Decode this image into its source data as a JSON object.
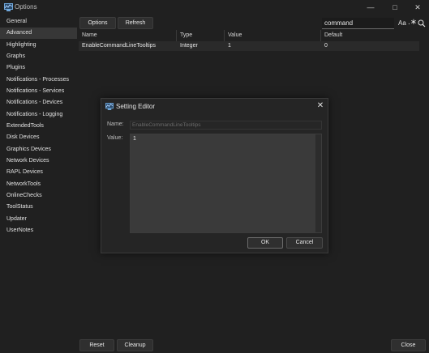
{
  "window": {
    "title": "Options"
  },
  "sidebar": {
    "items": [
      {
        "label": "General"
      },
      {
        "label": "Advanced"
      },
      {
        "label": "Highlighting"
      },
      {
        "label": "Graphs"
      },
      {
        "label": "Plugins"
      },
      {
        "label": "Notifications - Processes"
      },
      {
        "label": "Notifications - Services"
      },
      {
        "label": "Notifications - Devices"
      },
      {
        "label": "Notifications - Logging"
      },
      {
        "label": "ExtendedTools"
      },
      {
        "label": "Disk Devices"
      },
      {
        "label": "Graphics Devices"
      },
      {
        "label": "Network Devices"
      },
      {
        "label": "RAPL Devices"
      },
      {
        "label": "NetworkTools"
      },
      {
        "label": "OnlineChecks"
      },
      {
        "label": "ToolStatus"
      },
      {
        "label": "Updater"
      },
      {
        "label": "UserNotes"
      }
    ],
    "selected": "Advanced"
  },
  "toolbar": {
    "options_label": "Options",
    "refresh_label": "Refresh"
  },
  "search": {
    "value": "command",
    "match_case_icon": "Aa"
  },
  "table": {
    "columns": [
      "Name",
      "Type",
      "Value",
      "Default"
    ],
    "rows": [
      {
        "name": "EnableCommandLineTooltips",
        "type": "Integer",
        "value": "1",
        "default": "0"
      }
    ]
  },
  "footer": {
    "reset_label": "Reset",
    "cleanup_label": "Cleanup",
    "close_label": "Close"
  },
  "dialog": {
    "title": "Setting Editor",
    "name_label": "Name:",
    "name_value": "EnableCommandLineTooltips",
    "value_label": "Value:",
    "value_text": "1",
    "ok_label": "OK",
    "cancel_label": "Cancel"
  }
}
